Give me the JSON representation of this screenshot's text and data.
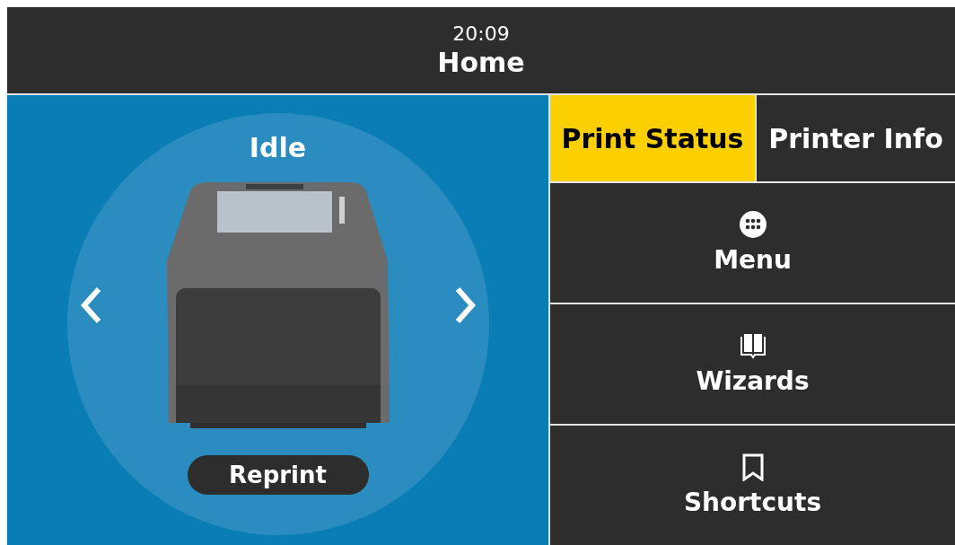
{
  "header": {
    "time": "20:09",
    "title": "Home"
  },
  "status": {
    "label": "Idle",
    "reprint": "Reprint"
  },
  "tabs": [
    {
      "label": "Print Status",
      "selected": true
    },
    {
      "label": "Printer Info",
      "selected": false
    }
  ],
  "menu": [
    {
      "kind": "menu",
      "label": "Menu"
    },
    {
      "kind": "wizards",
      "label": "Wizards"
    },
    {
      "kind": "shortcuts",
      "label": "Shortcuts"
    }
  ]
}
